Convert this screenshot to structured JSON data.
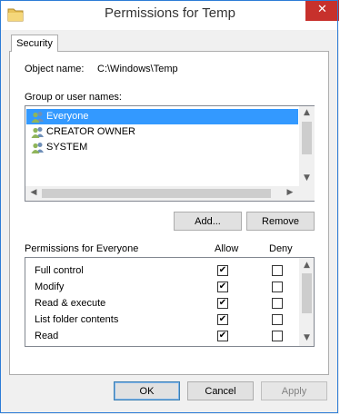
{
  "window": {
    "title": "Permissions for Temp",
    "close_glyph": "✕"
  },
  "tabs": [
    {
      "label": "Security"
    }
  ],
  "object": {
    "label": "Object name:",
    "value": "C:\\Windows\\Temp"
  },
  "group_list": {
    "label": "Group or user names:",
    "items": [
      {
        "name": "Everyone",
        "icon": "users-icon",
        "selected": true
      },
      {
        "name": "CREATOR OWNER",
        "icon": "users-icon",
        "selected": false
      },
      {
        "name": "SYSTEM",
        "icon": "users-icon",
        "selected": false
      }
    ]
  },
  "buttons": {
    "add": "Add...",
    "remove": "Remove",
    "ok": "OK",
    "cancel": "Cancel",
    "apply": "Apply"
  },
  "permissions": {
    "label": "Permissions for Everyone",
    "allow_header": "Allow",
    "deny_header": "Deny",
    "rows": [
      {
        "name": "Full control",
        "allow": true,
        "deny": false
      },
      {
        "name": "Modify",
        "allow": true,
        "deny": false
      },
      {
        "name": "Read & execute",
        "allow": true,
        "deny": false
      },
      {
        "name": "List folder contents",
        "allow": true,
        "deny": false
      },
      {
        "name": "Read",
        "allow": true,
        "deny": false
      }
    ]
  },
  "scroll_arrows": {
    "up": "▲",
    "down": "▼",
    "left": "◀",
    "right": "▶"
  },
  "colors": {
    "selection": "#3399ff",
    "close": "#c7312c",
    "border": "#2d7cd6"
  }
}
